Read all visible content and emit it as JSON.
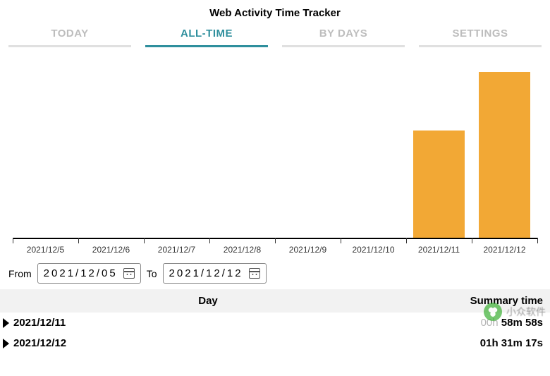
{
  "title": "Web Activity Time Tracker",
  "tabs": {
    "today": "TODAY",
    "alltime": "ALL-TIME",
    "bydays": "BY DAYS",
    "settings": "SETTINGS"
  },
  "range": {
    "from_label": "From",
    "from_value": "2021/12/05",
    "to_label": "To",
    "to_value": "2021/12/12"
  },
  "table": {
    "head_day": "Day",
    "head_sum": "Summary time",
    "rows": [
      {
        "day": "2021/12/11",
        "hh": "00h ",
        "rest": "58m 58s"
      },
      {
        "day": "2021/12/12",
        "hh": "",
        "rest": "01h 31m 17s"
      }
    ]
  },
  "watermark": "小众软件",
  "chart_data": {
    "type": "bar",
    "title": "",
    "xlabel": "",
    "ylabel": "",
    "ylim": [
      0,
      100
    ],
    "categories": [
      "2021/12/5",
      "2021/12/6",
      "2021/12/7",
      "2021/12/8",
      "2021/12/9",
      "2021/12/10",
      "2021/12/11",
      "2021/12/12"
    ],
    "values": [
      0,
      0,
      0,
      0,
      0,
      0,
      59,
      91
    ],
    "bar_color": "#f2a835"
  }
}
